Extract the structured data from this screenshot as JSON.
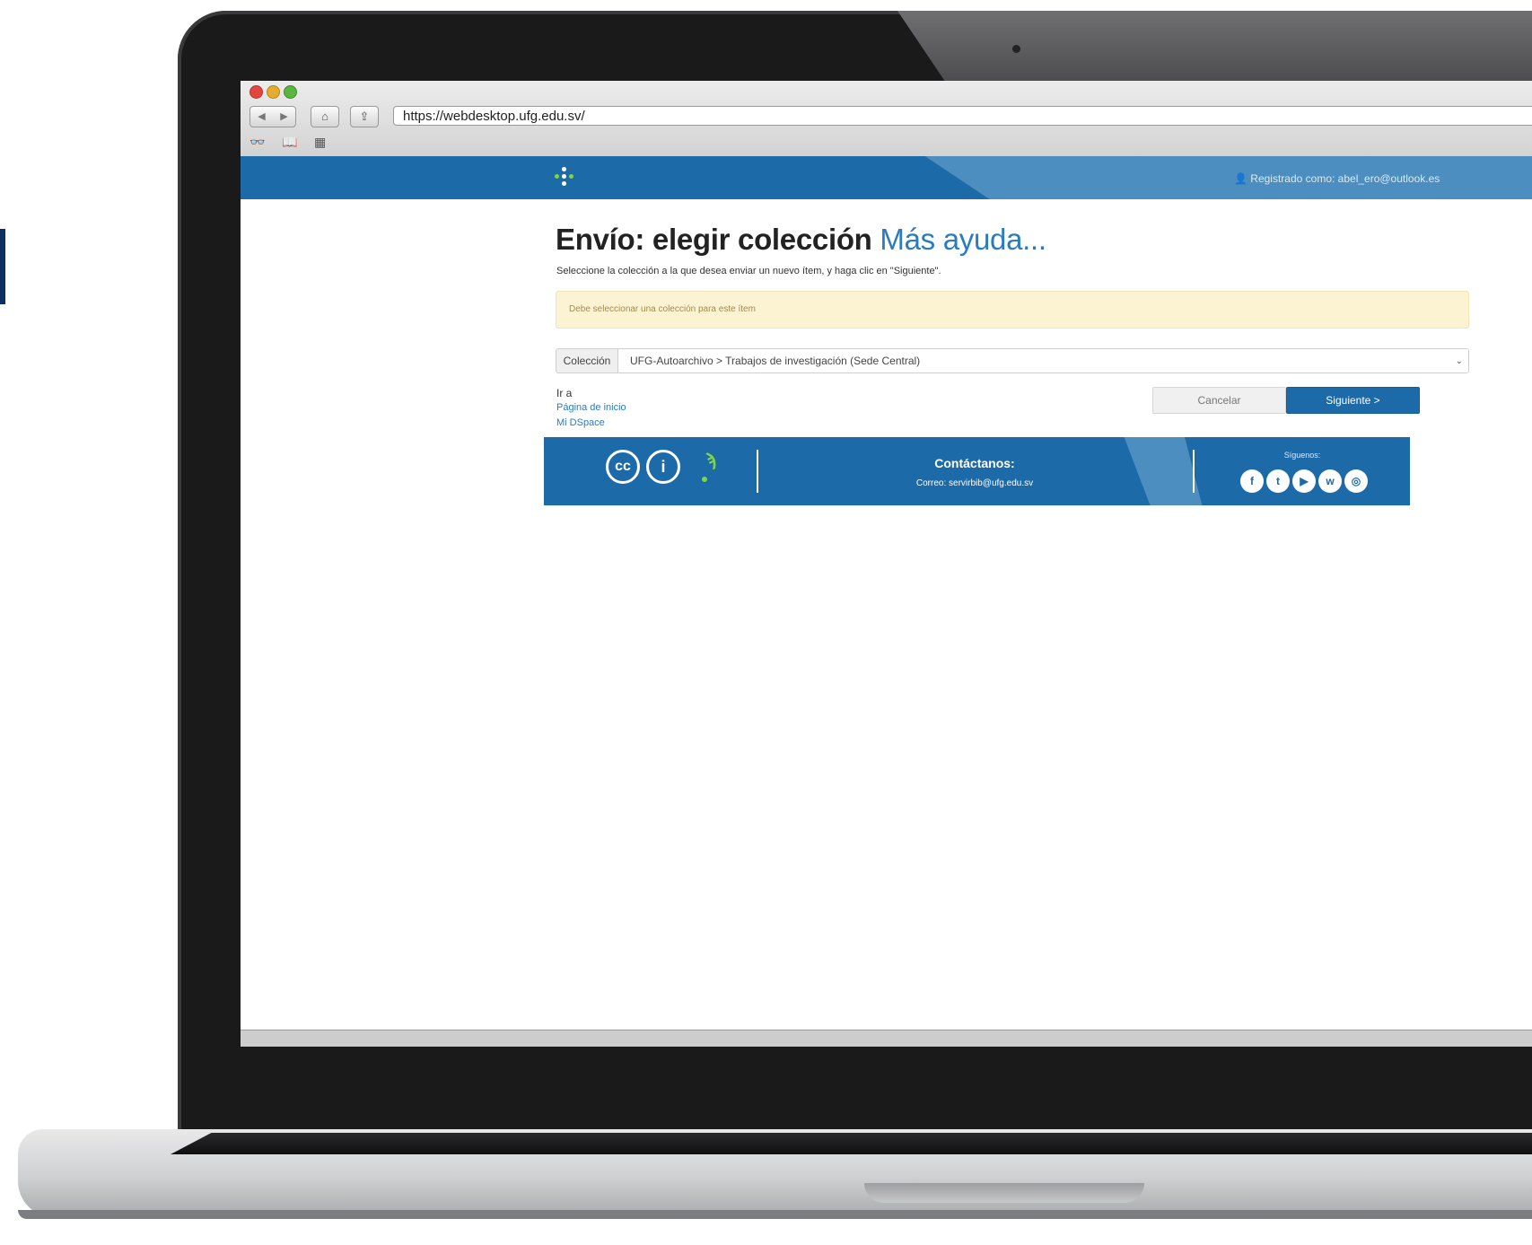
{
  "browser": {
    "url": "https://webdesktop.ufg.edu.sv/",
    "nav": {
      "back_glyph": "◀",
      "forward_glyph": "▶",
      "home_glyph": "⌂",
      "share_glyph": "⇪"
    },
    "bookmarks": {
      "reader_glyph": "👓",
      "book_glyph": "📖",
      "grid_glyph": "▦"
    }
  },
  "header": {
    "user_menu": "Registrado como: abel_ero@outlook.es"
  },
  "main": {
    "title": "Envío: elegir colección",
    "help_link": "Más ayuda...",
    "instructions": "Seleccione la colección a la que desea enviar un nuevo ítem, y haga clic en \"Siguiente\".",
    "alert": "Debe seleccionar una colección para este ítem",
    "collection_select": {
      "label": "Colección",
      "selected": "UFG-Autoarchivo > Trabajos de investigación (Sede Central)",
      "caret": "⌄"
    },
    "cancel_button": "Cancelar",
    "next_button": "Siguiente >",
    "goto": {
      "label": "Ir a",
      "home": "Página de inicio",
      "mydspace": "Mi DSpace"
    }
  },
  "footer": {
    "cc_text": "cc",
    "by_glyph": "i",
    "logo_glyph": "ϡ",
    "contact_title": "Contáctanos:",
    "contact_email": "Correo: servirbib@ufg.edu.sv",
    "follow_label": "Síguenos:",
    "social": [
      {
        "name": "facebook",
        "glyph": "f"
      },
      {
        "name": "twitter",
        "glyph": "t"
      },
      {
        "name": "youtube",
        "glyph": "▶"
      },
      {
        "name": "whatsapp",
        "glyph": "w"
      },
      {
        "name": "instagram",
        "glyph": "◎"
      }
    ]
  },
  "colors": {
    "brand_blue": "#1d6aa8",
    "brand_light_blue": "#4d8ec0",
    "link_blue": "#2a7bbf",
    "accent_green": "#7fd54a",
    "alert_bg": "#fcf3d2"
  }
}
